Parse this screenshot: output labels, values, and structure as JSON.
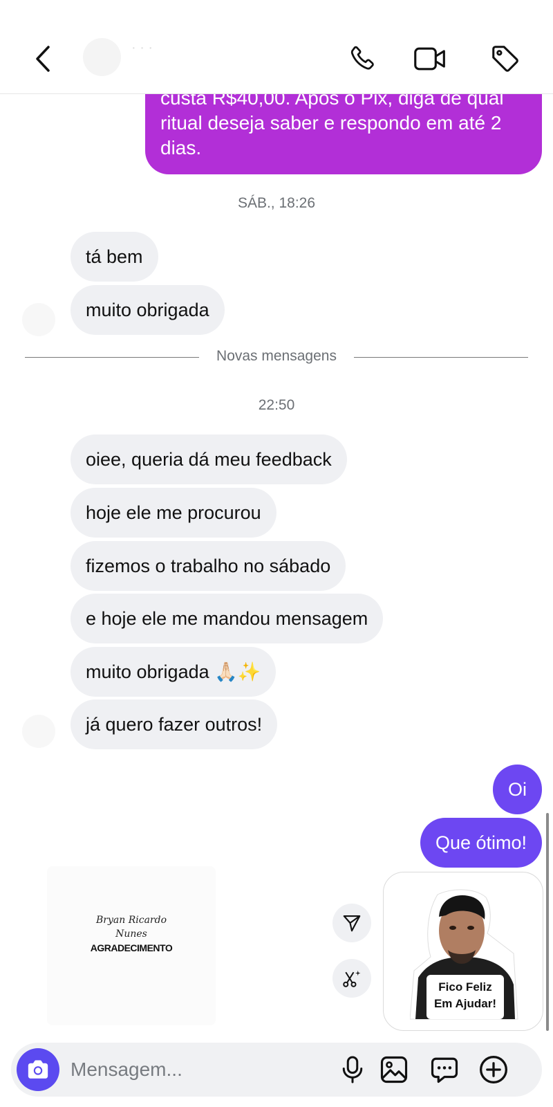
{
  "header": {
    "contact_name": "· · ·"
  },
  "messages_top": {
    "outgoing_long": "custa R$40,00. Após o Pix, diga de qual ritual deseja saber e respondo em até 2 dias."
  },
  "timestamp_1": "SÁB., 18:26",
  "group_1": [
    "tá bem",
    "muito obrigada"
  ],
  "new_messages_label": "Novas mensagens",
  "timestamp_2": "22:50",
  "group_2": [
    "oiee, queria dá meu feedback",
    "hoje ele me procurou",
    "fizemos o trabalho no sábado",
    "e hoje ele me mandou mensagem",
    "muito obrigada 🙏🏻✨",
    "já quero fazer outros!"
  ],
  "outgoing": [
    "Oi",
    "Que ótimo!"
  ],
  "shared_card": {
    "signature_line1": "Bryan Ricardo",
    "signature_line2": "Nunes",
    "title": "AGRADECIMENTO"
  },
  "sticker": {
    "line1": "Fico Feliz",
    "line2": "Em Ajudar!"
  },
  "composer": {
    "placeholder": "Mensagem..."
  },
  "colors": {
    "outgoing_bubble": "#6d47f2",
    "outgoing_bubble_alt": "#b22fd7",
    "incoming_bubble": "#eff0f3",
    "camera_button": "#5b4af0"
  }
}
